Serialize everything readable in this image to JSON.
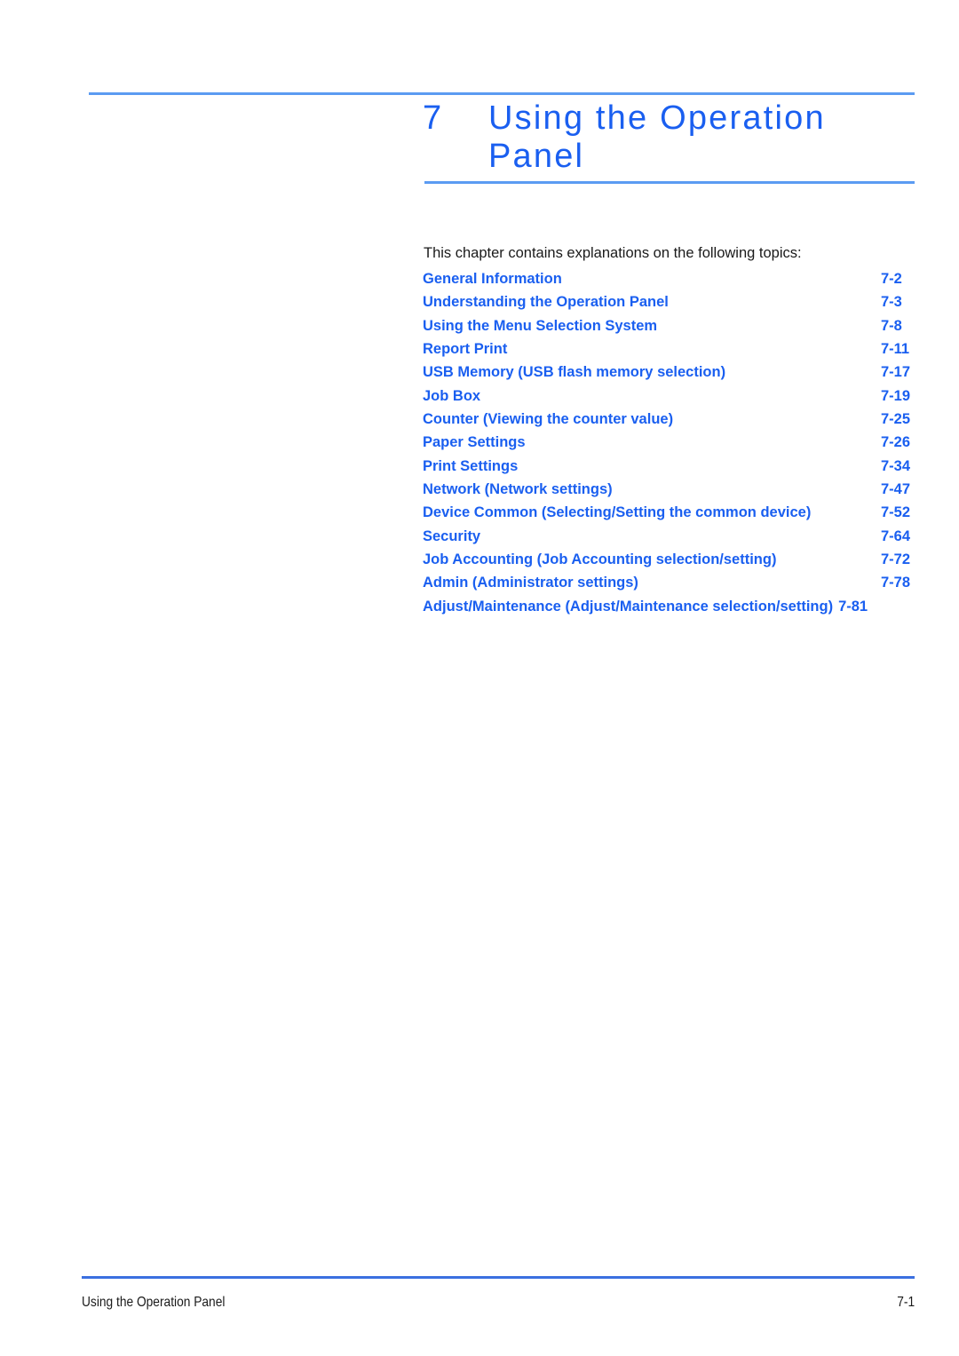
{
  "document": {
    "chapter_number": "7",
    "chapter_title_line1": "Using the Operation",
    "chapter_title_line2": "Panel",
    "intro": "This chapter contains explanations on the following topics:",
    "accent_color": "#1a5ff0",
    "rule_color": "#5b9bf2",
    "footer_rule_color": "#3b6fe0"
  },
  "toc": [
    {
      "label": "General Information",
      "page": "7-2"
    },
    {
      "label": "Understanding the Operation Panel",
      "page": "7-3"
    },
    {
      "label": "Using the Menu Selection System",
      "page": "7-8"
    },
    {
      "label": "Report Print",
      "page": "7-11"
    },
    {
      "label": "USB Memory (USB flash memory selection)",
      "page": "7-17"
    },
    {
      "label": "Job Box",
      "page": "7-19"
    },
    {
      "label": "Counter (Viewing the counter value)",
      "page": "7-25"
    },
    {
      "label": "Paper Settings",
      "page": "7-26"
    },
    {
      "label": "Print Settings",
      "page": "7-34"
    },
    {
      "label": "Network (Network settings)",
      "page": "7-47"
    },
    {
      "label": "Device Common (Selecting/Setting the common device)",
      "page": "7-52"
    },
    {
      "label": "Security",
      "page": "7-64"
    },
    {
      "label": "Job Accounting (Job Accounting selection/setting)",
      "page": "7-72"
    },
    {
      "label": "Admin (Administrator settings)",
      "page": "7-78"
    },
    {
      "label": "Adjust/Maintenance (Adjust/Maintenance selection/setting)",
      "page": "7-81"
    }
  ],
  "footer": {
    "title": "Using the Operation Panel",
    "page": "7-1"
  }
}
